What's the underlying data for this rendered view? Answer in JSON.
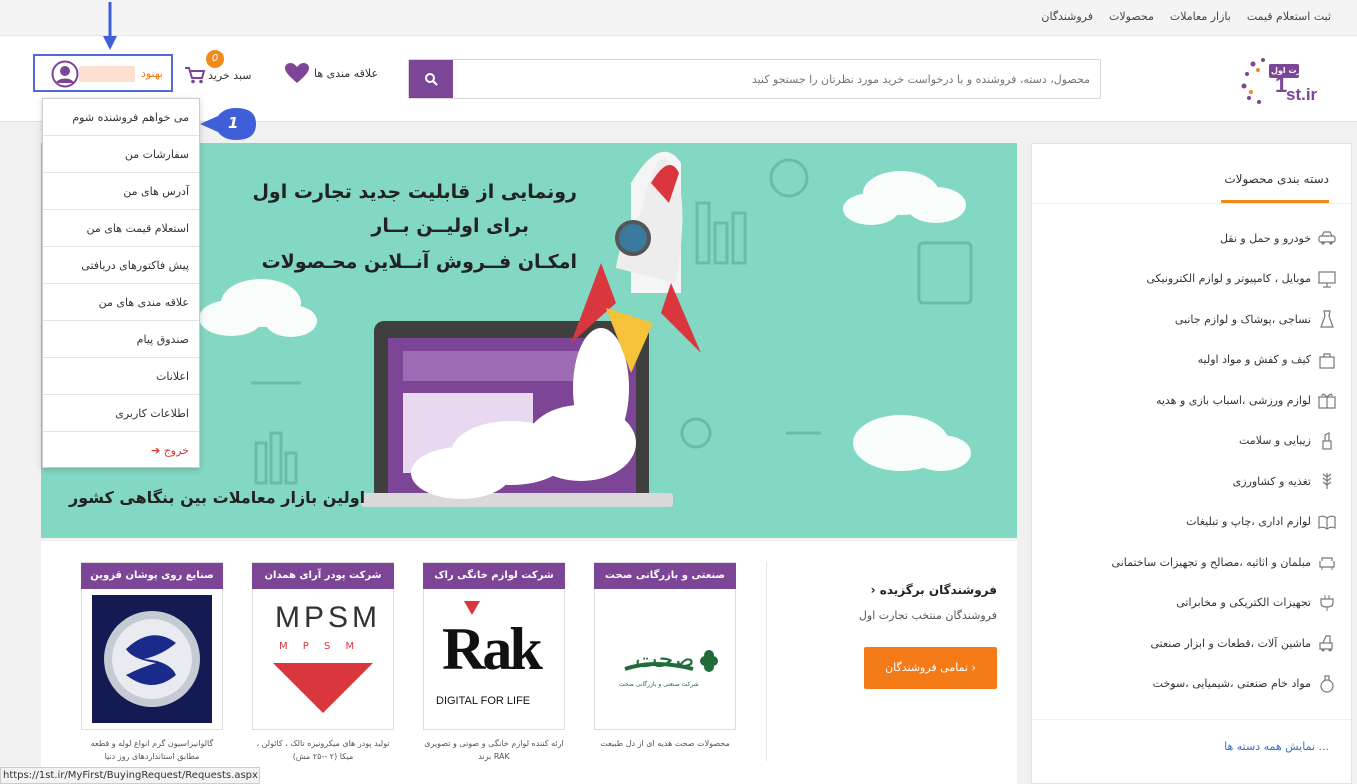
{
  "top_nav": {
    "links": [
      "ثبت استعلام قیمت",
      "بازار معاملات",
      "محصولات",
      "فروشندگان"
    ]
  },
  "header": {
    "logo_text": "تجارت اول",
    "logo_domain": "1st.ir",
    "search_placeholder": "محصول، دسته، فروشنده و یا درخواست خرید مورد نظرتان را جستجو کنید",
    "wishlist_label": "علاقه مندی ها",
    "cart_label": "سبد خرید",
    "cart_count": "0",
    "user_name": "بهنود"
  },
  "user_menu": {
    "items": [
      "می خواهم فروشنده شوم",
      "سفارشات من",
      "آدرس های من",
      "استعلام قیمت های من",
      "پیش فاکتورهای دریافتی",
      "علاقه مندی های من",
      "صندوق پیام",
      "اعلانات",
      "اطلاعات کاربری",
      "خروج"
    ]
  },
  "callout": {
    "number": "1"
  },
  "sidebar": {
    "title": "دسته بندی محصولات",
    "categories": [
      {
        "label": "خودرو و حمل و نقل",
        "icon": "car-icon"
      },
      {
        "label": "موبایل ، کامپیوتر و لوازم الکترونیکی",
        "icon": "monitor-icon"
      },
      {
        "label": "نساجی ،پوشاک و لوازم جانبی",
        "icon": "dress-icon"
      },
      {
        "label": "کیف و کفش و مواد اولیه",
        "icon": "bag-icon"
      },
      {
        "label": "لوازم ورزشی ،اسباب بازی و هدیه",
        "icon": "gift-icon"
      },
      {
        "label": "زیبایی و سلامت",
        "icon": "lipstick-icon"
      },
      {
        "label": "تغذیه و کشاورزی",
        "icon": "wheat-icon"
      },
      {
        "label": "لوازم اداری ،چاپ و تبلیغات",
        "icon": "book-icon"
      },
      {
        "label": "مبلمان و اثاثیه ،مصالح و تجهیزات ساختمانی",
        "icon": "sofa-icon"
      },
      {
        "label": "تجهیزات الکتریکی و مخابراتی",
        "icon": "plug-icon"
      },
      {
        "label": "ماشین آلات ،قطعات و ابزار صنعتی",
        "icon": "machine-icon"
      },
      {
        "label": "مواد خام صنعتی ،شیمیایی ،سوخت",
        "icon": "flask-icon"
      }
    ],
    "show_all": "نمایش همه دسته ها ..."
  },
  "banner": {
    "line1": "رونمایی از قابلیت جدید تجارت اول",
    "line2": "برای اولیــن بــار",
    "line3": "امکـان فــروش آنــلاین محـصولات",
    "footer": "اولین بازار معاملات بین بنگاهی کشور"
  },
  "featured": {
    "title": "فروشندگان برگزیده",
    "subtitle": "فروشندگان منتخب تجارت اول",
    "all_button": "تمامی فروشندگان",
    "vendors": [
      {
        "name": "صنعتی و بازرگانی صحت",
        "desc": "محصولات صحت هدیه ای از دل طبیعت",
        "logo_text": "صحت",
        "logo_sub": "شرکت صنعتی و بازرگانی صحت"
      },
      {
        "name": "شرکت لوازم خانگی راک",
        "desc": "ارئه کننده لوازم خانگی و صوتی و تصویری برند RAK",
        "logo_text": "Rak",
        "logo_sub": "DIGITAL FOR LIFE"
      },
      {
        "name": "شرکت پودر آرای همدان",
        "desc": "تولید پودر های میکرونیزه تالک ، کائولن ، میکا (۲ --۲۵ مش)",
        "logo_text": "MPSM",
        "logo_sub": "M P S M"
      },
      {
        "name": "صنایع روی پوشان قزوین",
        "desc": "گالوانیزاسیون گرم انواع لوله و قطعه مطابق استانداردهای روز دنیا",
        "logo_text": "",
        "logo_sub": ""
      }
    ]
  },
  "status_bar": {
    "url": "https://1st.ir/MyFirst/BuyingRequest/Requests.aspx"
  },
  "colors": {
    "accent_purple": "#7d4595",
    "accent_orange": "#f47a17",
    "banner_bg": "#83d8c3",
    "highlight_blue": "#4d6ad6"
  }
}
